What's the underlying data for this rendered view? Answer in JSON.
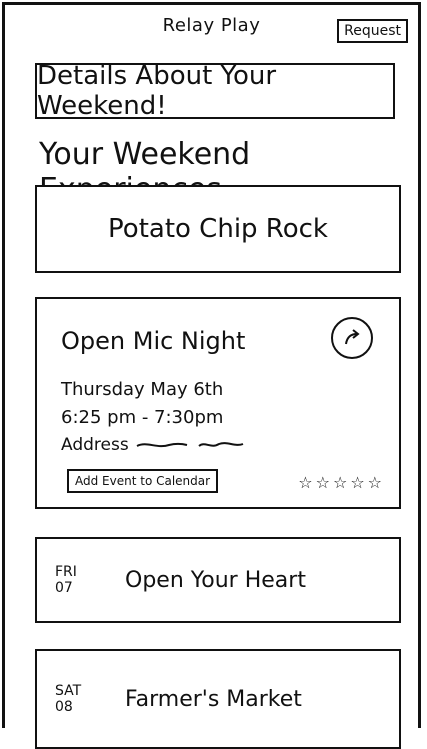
{
  "app": {
    "title": "Relay Play",
    "request_label": "Request"
  },
  "banner": {
    "text": "Details About Your Weekend!"
  },
  "section": {
    "title": "Your Weekend Experiences"
  },
  "featured": {
    "title": "Potato Chip Rock"
  },
  "event": {
    "title": "Open Mic Night",
    "date": "Thursday May 6th",
    "time": "6:25 pm - 7:30pm",
    "address_label": "Address",
    "add_calendar_label": "Add Event to Calendar",
    "rating_stars": "☆☆☆☆☆",
    "share_icon": "share-arrow-icon"
  },
  "list": [
    {
      "day": "FRI",
      "date": "07",
      "title": "Open Your Heart"
    },
    {
      "day": "SAT",
      "date": "08",
      "title": "Farmer's Market"
    }
  ]
}
